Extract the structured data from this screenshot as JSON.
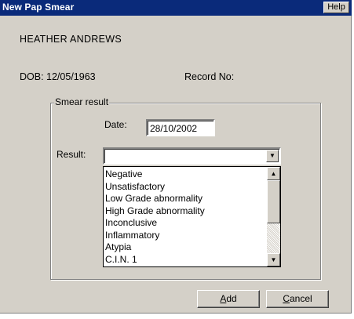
{
  "window": {
    "title": "New Pap Smear",
    "help_label": "Help"
  },
  "patient": {
    "name": "HEATHER ANDREWS",
    "dob": "DOB: 12/05/1963",
    "record_label": "Record No:"
  },
  "smear_result": {
    "group_label": "Smear result",
    "date_label": "Date:",
    "date_value": "28/10/2002",
    "result_label": "Result:",
    "result_value": "",
    "options": [
      "Negative",
      "Unsatisfactory",
      "Low Grade abnormality",
      "High Grade abnormality",
      "Inconclusive",
      "Inflammatory",
      "Atypia",
      "C.I.N. 1"
    ]
  },
  "buttons": {
    "add_hotkey": "A",
    "add_rest": "dd",
    "cancel_hotkey": "C",
    "cancel_rest": "ancel"
  },
  "icons": {
    "dropdown": "chevron-down-icon",
    "scroll_up": "arrow-up-icon",
    "scroll_down": "arrow-down-icon"
  }
}
